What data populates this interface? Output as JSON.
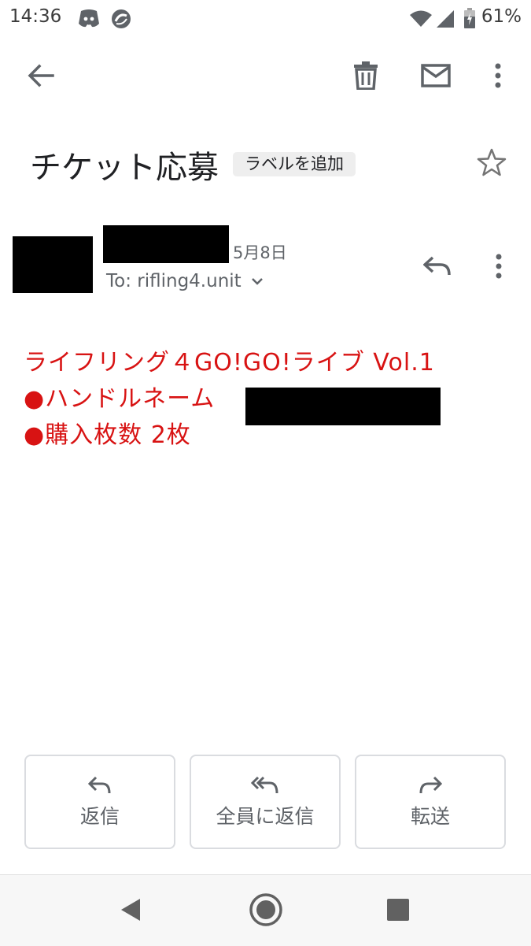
{
  "status_bar": {
    "time": "14:36",
    "icons": [
      "discord-icon",
      "sync-icon",
      "wifi-icon",
      "signal-icon",
      "battery-icon"
    ],
    "battery": "61%"
  },
  "toolbar": {
    "icons": [
      "back-arrow-icon",
      "trash-icon",
      "mail-icon",
      "more-vert-icon"
    ]
  },
  "email": {
    "subject": "チケット応募",
    "label_button": "ラベルを追加",
    "date": "5月8日",
    "to": "To: rifling4.unit",
    "body": {
      "line1": "ライフリング４GO!GO!ライブ Vol.1",
      "line2": "●ハンドルネーム",
      "line3": "●購入枚数 2枚"
    },
    "color_accent": "#d81313"
  },
  "actions": {
    "reply": "返信",
    "reply_all": "全員に返信",
    "forward": "転送"
  },
  "nav": {
    "icons": [
      "nav-back-icon",
      "nav-home-icon",
      "nav-recents-icon"
    ]
  }
}
